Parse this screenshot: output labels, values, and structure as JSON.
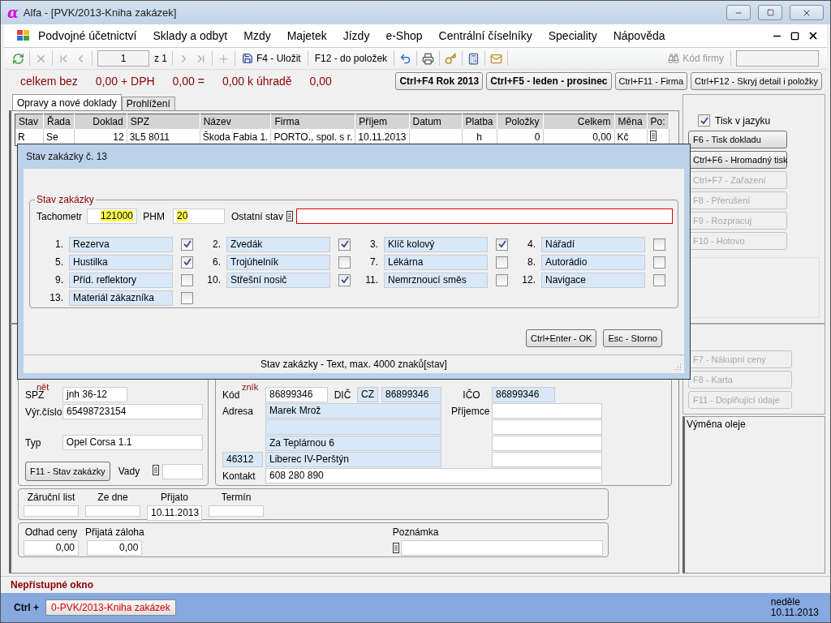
{
  "window": {
    "logo": "α",
    "title": "Alfa - [PVK/2013-Kniha zakázek]"
  },
  "menu": [
    "Podvojné účetnictví",
    "Sklady a odbyt",
    "Mzdy",
    "Majetek",
    "Jízdy",
    "e-Shop",
    "Centrální číselníky",
    "Speciality",
    "Nápověda"
  ],
  "toolbar": {
    "page": "1",
    "page_count": "z 1",
    "save": "F4 - Uložit",
    "to_items": "F12 - do položek",
    "company_code": "Kód firmy"
  },
  "totals": [
    "celkem bez",
    "0,00 + DPH",
    "0,00 =",
    "0,00 k úhradě",
    "0,00"
  ],
  "period_buttons": [
    {
      "label": "Ctrl+F4 Rok 2013",
      "bold": true
    },
    {
      "label": "Ctrl+F5 - leden - prosinec",
      "bold": true
    },
    {
      "label": "Ctrl+F11 - Firma",
      "bold": false
    },
    {
      "label": "Ctrl+F12 - Skryj detail i položky",
      "bold": false
    }
  ],
  "tabs": [
    {
      "label": "Opravy a nové doklady",
      "selected": true
    },
    {
      "label": "Prohlížení",
      "selected": false
    }
  ],
  "table": {
    "columns": [
      {
        "label": "Stav"
      },
      {
        "label": "Řada"
      },
      {
        "label": "Doklad"
      },
      {
        "label": "SPZ"
      },
      {
        "label": "Název"
      },
      {
        "label": "Firma"
      },
      {
        "label": "Příjem"
      },
      {
        "label": "Datum"
      },
      {
        "label": "Platba"
      },
      {
        "label": "Položky"
      },
      {
        "label": "Celkem"
      },
      {
        "label": "Měna"
      },
      {
        "label": "Po:",
        "kind": "memo"
      }
    ],
    "rows": [
      {
        "cells": [
          "R",
          "Se",
          "12",
          "3L5 8011",
          "Škoda Fabia 1.",
          "PORTO., spol. s r.",
          "10.11.2013",
          null,
          "h",
          "0",
          "0,00",
          "Kč",
          null
        ],
        "selected": false
      }
    ]
  },
  "right_panel": {
    "print_language": {
      "label": "Tisk v jazyku",
      "checked": true
    },
    "buttons": [
      {
        "label": "F6 - Tisk dokladu",
        "disabled": false
      },
      {
        "label": "Ctrl+F6 - Hromadný tisk",
        "disabled": false
      },
      {
        "label": "Ctrl+F7 - Zařazení",
        "disabled": true
      },
      {
        "label": "F8 - Přerušení",
        "disabled": true
      },
      {
        "label": "F9 - Rozpracuj",
        "disabled": true
      },
      {
        "label": "F10 - Hotovo",
        "disabled": true
      }
    ],
    "lower_buttons": [
      {
        "label": "F7 - Nákupní ceny",
        "disabled": true
      },
      {
        "label": "F8 - Karta",
        "disabled": true
      },
      {
        "label": "F11 - Doplňující údaje",
        "disabled": true
      }
    ],
    "note": "Výměna oleje"
  },
  "vehicle": {
    "legend": "nět",
    "spz_label": "SPZ",
    "spz": "jnh 36-12",
    "serial_label": "Výr.číslo",
    "serial": "65498723154",
    "type_label": "Typ",
    "type": "Opel Corsa 1.1",
    "status_button": "F11 - Stav zakázky",
    "defects_label": "Vady"
  },
  "customer": {
    "legend": "zník",
    "code_label": "Kód",
    "code": "86899346",
    "vat_label": "DIČ",
    "vat_prefix": "CZ",
    "vat": "86899346",
    "id_label": "IČO",
    "id": "86899346",
    "address_label": "Adresa",
    "name": "Marek Mrož",
    "street": "Za Teplárnou 6",
    "zip": "46312",
    "city": "Liberec IV-Perštýn",
    "contact_label": "Kontakt",
    "contact": "608 280 890",
    "recipient_label": "Příjemce"
  },
  "dates": [
    {
      "label": "Záruční list"
    },
    {
      "label": "Ze dne"
    },
    {
      "label": "Přijato",
      "value": "10.11.2013"
    },
    {
      "label": "Termín"
    }
  ],
  "amounts": [
    {
      "label": "Odhad ceny",
      "value": "0,00"
    },
    {
      "label": "Přijatá záloha",
      "value": "0,00"
    }
  ],
  "note_label": "Poznámka",
  "status_message": "Nepřístupné okno",
  "taskbar": {
    "prefix": "Ctrl +",
    "window_button": "0-PVK/2013-Kniha zakázek",
    "day": "neděle",
    "date": "10.11.2013"
  },
  "dialog": {
    "title": "Stav zakázky č. 13",
    "legend": "Stav zakázky",
    "odometer_label": "Tachometr",
    "odometer": "121000",
    "fuel_label": "PHM",
    "fuel": "20",
    "other_label": "Ostatní stav",
    "items": [
      {
        "number": "1.",
        "label": "Rezerva",
        "checked": true
      },
      {
        "number": "2.",
        "label": "Zvedák",
        "checked": true
      },
      {
        "number": "3.",
        "label": "Klíč kolový",
        "checked": true
      },
      {
        "number": "4.",
        "label": "Nářadí",
        "checked": false
      },
      {
        "number": "5.",
        "label": "Hustilka",
        "checked": true
      },
      {
        "number": "6.",
        "label": "Trojúhelník",
        "checked": false
      },
      {
        "number": "7.",
        "label": "Lékárna",
        "checked": false
      },
      {
        "number": "8.",
        "label": "Autorádio",
        "checked": false
      },
      {
        "number": "9.",
        "label": "Příd. reflektory",
        "checked": false
      },
      {
        "number": "10.",
        "label": "Střešní nosič",
        "checked": true
      },
      {
        "number": "11.",
        "label": "Nemrznoucí směs",
        "checked": false
      },
      {
        "number": "12.",
        "label": "Navigace",
        "checked": false
      },
      {
        "number": "13.",
        "label": "Materiál zákazníka",
        "checked": false
      }
    ],
    "buttons": [
      "Ctrl+Enter - OK",
      "Esc - Storno"
    ],
    "status": "Stav zakázky - Text, max. 4000 znaků[stav]"
  }
}
